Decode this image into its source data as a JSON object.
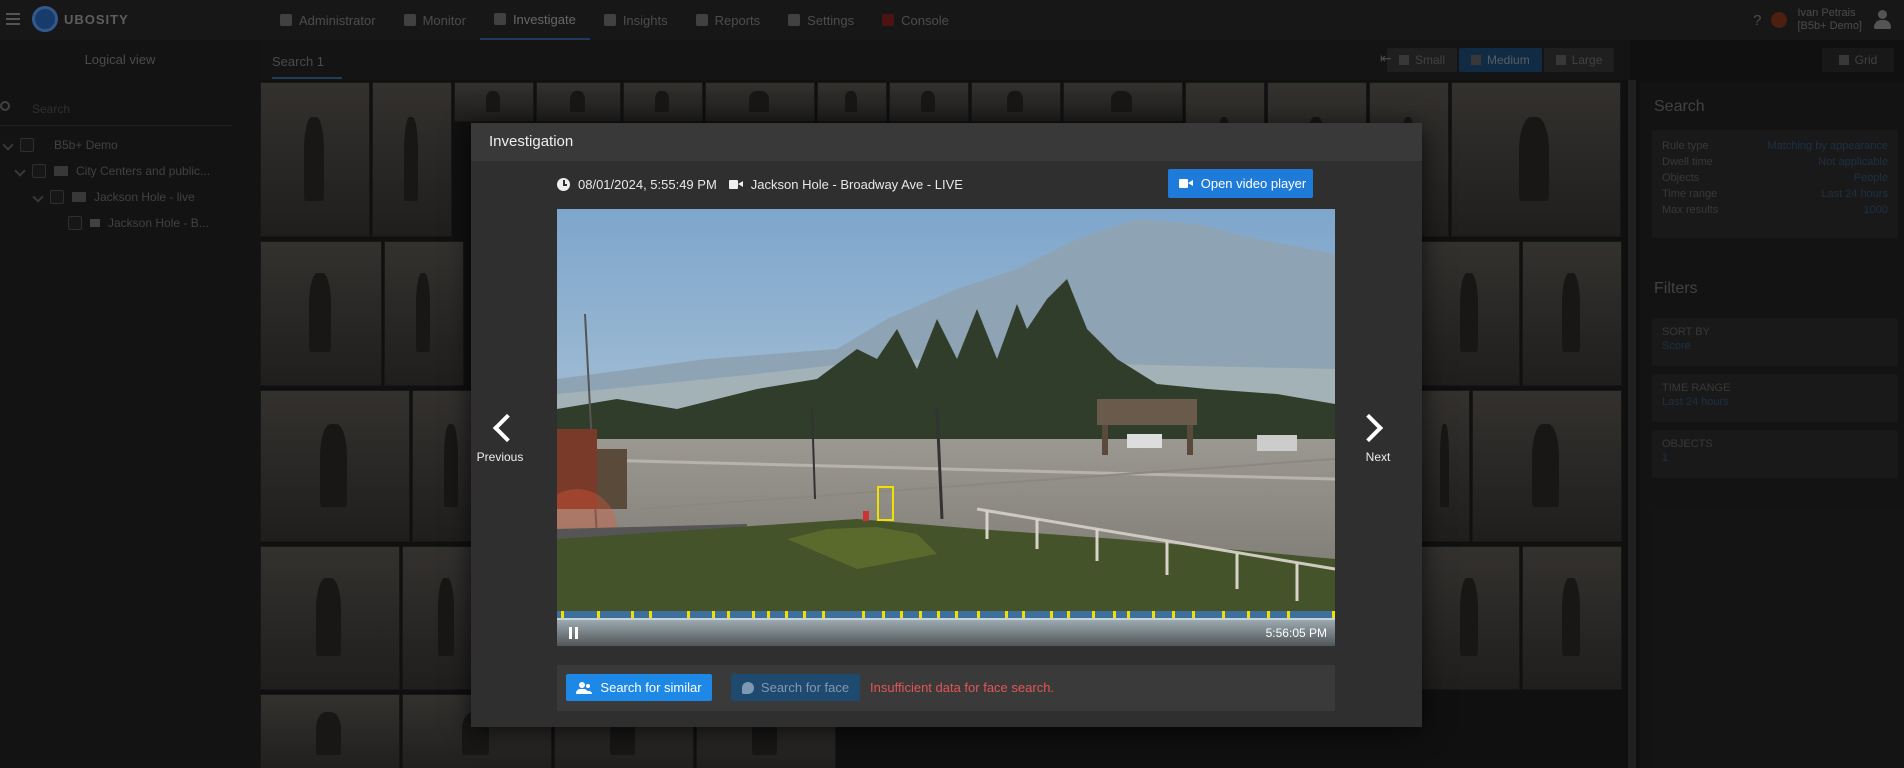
{
  "app": {
    "logo_text": "UBOSITY"
  },
  "nav": {
    "items": [
      {
        "label": "Administrator",
        "icon": "admin-icon"
      },
      {
        "label": "Monitor",
        "icon": "monitor-icon"
      },
      {
        "label": "Investigate",
        "icon": "search-icon",
        "active": true
      },
      {
        "label": "Insights",
        "icon": "insights-icon"
      },
      {
        "label": "Reports",
        "icon": "reports-icon"
      },
      {
        "label": "Settings",
        "icon": "gear-icon"
      },
      {
        "label": "Console",
        "icon": "console-icon"
      }
    ]
  },
  "user": {
    "name": "Ivan Petrais",
    "org": "[B5b+ Demo]"
  },
  "sidebar": {
    "title": "Logical view",
    "search_placeholder": "Search",
    "tree": [
      {
        "label": "B5b+ Demo"
      },
      {
        "label": "City Centers and public..."
      },
      {
        "label": "Jackson Hole - live"
      },
      {
        "label": "Jackson Hole - B..."
      }
    ]
  },
  "toolbar": {
    "tab_label": "Search 1",
    "size_options": [
      "Small",
      "Medium",
      "Large"
    ],
    "size_selected": "Medium",
    "grid_label": "Grid"
  },
  "right_panel": {
    "search_heading": "Search",
    "rows": [
      {
        "k": "Rule type",
        "v": "Matching by appearance"
      },
      {
        "k": "Dwell time",
        "v": "Not applicable"
      },
      {
        "k": "Objects",
        "v": "People"
      },
      {
        "k": "Time range",
        "v": "Last 24 hours"
      },
      {
        "k": "Max results",
        "v": "1000"
      }
    ],
    "filters_heading": "Filters",
    "filters": [
      {
        "k": "SORT BY",
        "v": "Score"
      },
      {
        "k": "TIME RANGE",
        "v": "Last 24 hours"
      },
      {
        "k": "OBJECTS",
        "v": "1"
      }
    ]
  },
  "modal": {
    "title": "Investigation",
    "datetime": "08/01/2024, 5:55:49 PM",
    "camera": "Jackson Hole - Broadway Ave - LIVE",
    "open_video_label": "Open video player",
    "video_time": "5:56:05 PM",
    "previous_label": "Previous",
    "next_label": "Next",
    "search_similar_label": "Search for similar",
    "search_face_label": "Search for face",
    "face_error": "Insufficient data for face search.",
    "timeline_ticks": [
      4,
      40,
      74,
      92,
      130,
      155,
      170,
      195,
      210,
      228,
      246,
      265,
      305,
      325,
      343,
      362,
      380,
      398,
      420,
      448,
      465,
      493,
      510,
      535,
      556,
      570,
      595,
      615,
      635,
      665,
      690,
      710,
      730,
      775
    ],
    "timeline_color": "#3f6f9c",
    "tick_color": "#f2e000",
    "detection_box_color": "#f0e000"
  }
}
